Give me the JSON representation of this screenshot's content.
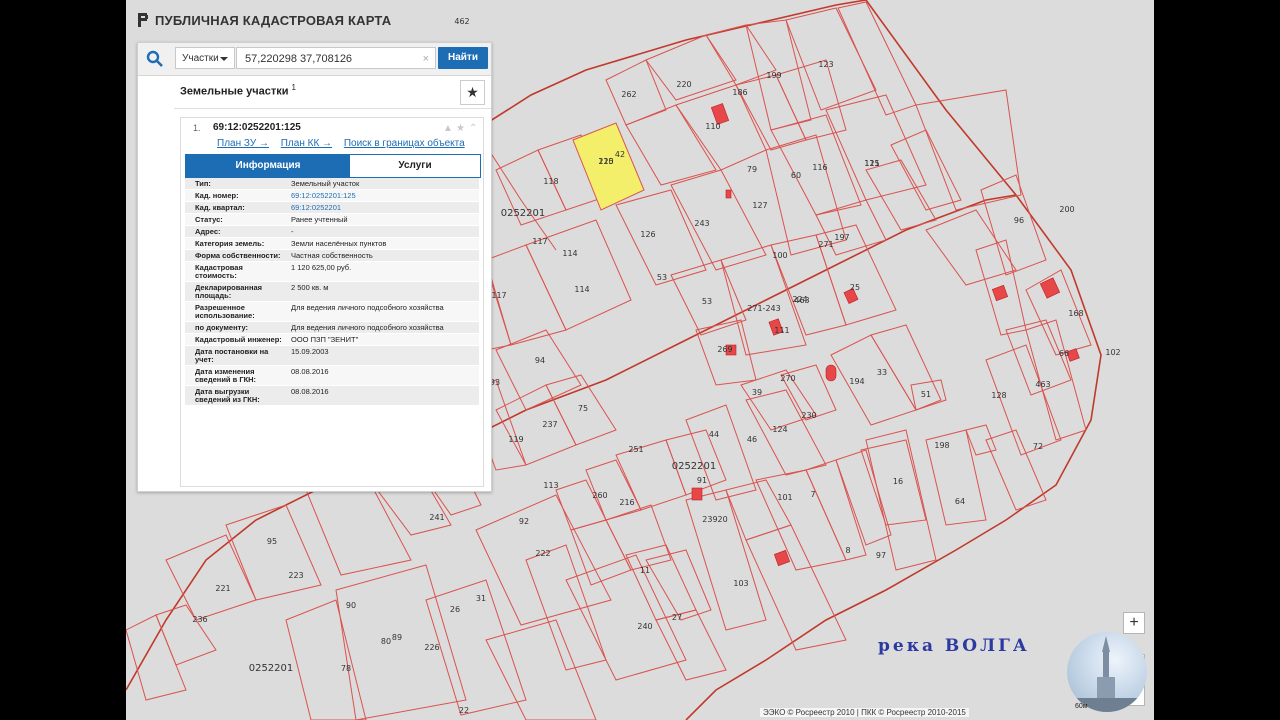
{
  "app": {
    "title": "ПУБЛИЧНАЯ КАДАСТРОВАЯ КАРТА"
  },
  "search": {
    "type_label": "Участки",
    "query": "57,220298 37,708126",
    "find_label": "Найти",
    "clear": "×"
  },
  "results": {
    "section_title": "Земельные участки",
    "count": "1",
    "favorite_icon": "★",
    "card": {
      "index": "1.",
      "number": "69:12:0252201:125",
      "links": [
        "План ЗУ →",
        "План КК →",
        "Поиск в границах объекта →"
      ],
      "tabs": [
        "Информация",
        "Услуги"
      ],
      "rows": [
        {
          "key": "Тип:",
          "value": "Земельный участок"
        },
        {
          "key": "Кад. номер:",
          "value": "69:12:0252201:125"
        },
        {
          "key": "Кад. квартал:",
          "value": "69:12:0252201"
        },
        {
          "key": "Статус:",
          "value": "Ранее учтенный"
        },
        {
          "key": "Адрес:",
          "value": "-"
        },
        {
          "key": "Категория земель:",
          "value": "Земли населённых пунктов"
        },
        {
          "key": "Форма собственности:",
          "value": "Частная собственность"
        },
        {
          "key": "Кадастровая стоимость:",
          "value": "1 120 625,00 руб."
        },
        {
          "key": "Декларированная площадь:",
          "value": "2 500 кв. м"
        },
        {
          "key": "Разрешенное использование:",
          "value": "Для ведения личного подсобного хозяйства"
        },
        {
          "key": "по документу:",
          "value": "Для ведения личного подсобного хозяйства"
        },
        {
          "key": "Кадастровый инженер:",
          "value": "ООО ПЗП \"ЗЕНИТ\""
        },
        {
          "key": "Дата постановки на учет:",
          "value": "15.09.2003"
        },
        {
          "key": "Дата изменения сведений в ГКН:",
          "value": "08.08.2016"
        },
        {
          "key": "Дата выгрузки сведений из ГКН:",
          "value": "08.08.2016"
        }
      ]
    }
  },
  "map": {
    "parcel_labels": [
      "462",
      "123",
      "199",
      "220",
      "186",
      "262",
      "110",
      "115",
      "121",
      "42",
      "125",
      "210",
      "118",
      "0252201",
      "79",
      "60",
      "116",
      "127",
      "117",
      "114",
      "126",
      "243",
      "271",
      "197",
      "117",
      "114",
      "53",
      "100",
      "463",
      "96",
      "200",
      "53",
      "271-243",
      "224",
      "25",
      "168",
      "269",
      "111",
      "94",
      "93",
      "75",
      "237",
      "119",
      "39",
      "270",
      "194",
      "33",
      "51",
      "66",
      "128",
      "463",
      "72",
      "102",
      "44",
      "124",
      "230",
      "46",
      "198",
      "0252201",
      "251",
      "91",
      "113",
      "216",
      "260",
      "241",
      "92",
      "222",
      "95",
      "223",
      "221",
      "236",
      "23920",
      "103",
      "101",
      "7",
      "8",
      "97",
      "16",
      "64",
      "11",
      "240",
      "27",
      "26",
      "31",
      "90",
      "226",
      "89",
      "78",
      "80",
      "22",
      "0252201",
      "12",
      "69"
    ],
    "river_label": "река ВОЛГА",
    "highlight_color": "#f3ef6b",
    "parcel_border_color": "#d9534f"
  },
  "controls": {
    "zoom_in": "+",
    "zoom_out": "−",
    "more": "⋯"
  },
  "footer": {
    "copyright": "ЭЭКО © Росреестр 2010 | ПКК © Росреестр 2010-2015",
    "scale": "60м"
  }
}
